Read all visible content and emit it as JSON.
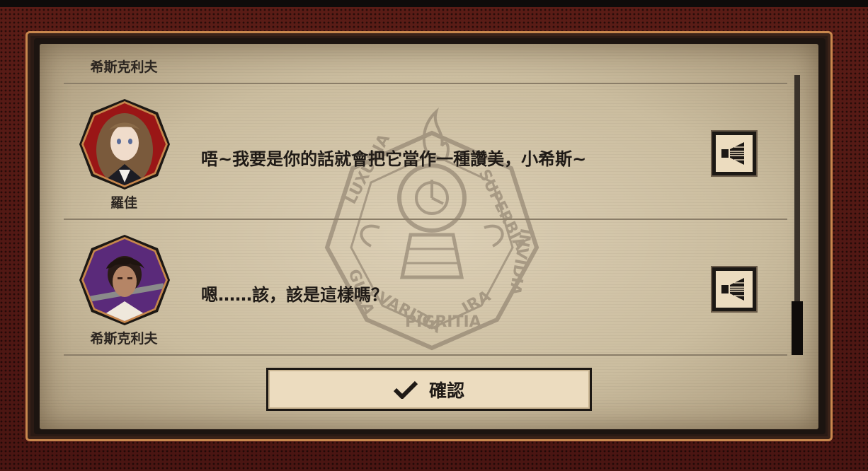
{
  "dialog_log": {
    "entries": [
      {
        "speaker": "希斯克利夫",
        "text": ""
      },
      {
        "speaker": "羅佳",
        "text": "唔~我要是你的話就會把它當作一種讚美，小希斯~",
        "avatar": "rodion-portrait",
        "voice_icon": "speaker-icon"
      },
      {
        "speaker": "希斯克利夫",
        "text": "嗯……該，該是這樣嗎？",
        "avatar": "heathcliff-portrait",
        "voice_icon": "speaker-icon"
      }
    ],
    "confirm_label": "確認",
    "confirm_icon": "checkmark-icon"
  },
  "colors": {
    "frame_red": "#4a1512",
    "frame_bronze": "#c8874d",
    "parchment": "#ddd0b6",
    "button_fill": "#ecdcbf",
    "text": "#1f1a16"
  }
}
